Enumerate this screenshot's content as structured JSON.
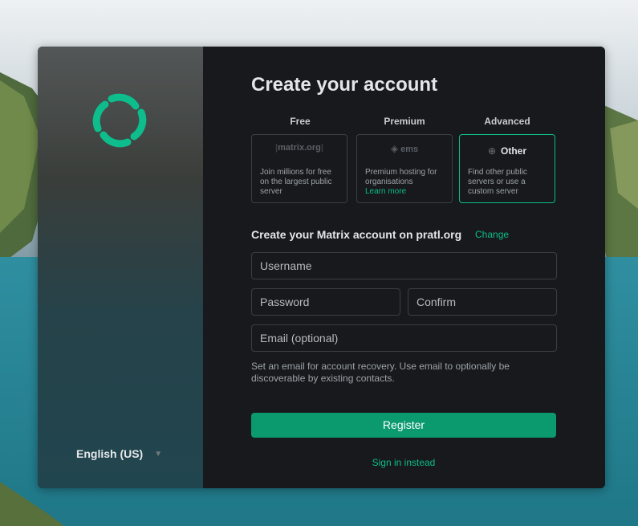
{
  "colors": {
    "accent": "#0dbd8b",
    "button": "#0b9a6e",
    "panel": "#17191c"
  },
  "sidebar": {
    "logo_icon": "element-logo-icon",
    "language": "English (US)",
    "language_chevron_icon": "chevron-down-icon"
  },
  "header": {
    "title": "Create your account"
  },
  "server_options": [
    {
      "tier": "Free",
      "brand": "matrix.org",
      "description": "Join millions for free on the largest public server",
      "link": "",
      "selected": false
    },
    {
      "tier": "Premium",
      "brand": "ems",
      "description": "Premium hosting for organisations",
      "link": "Learn more",
      "selected": false
    },
    {
      "tier": "Advanced",
      "brand": "Other",
      "brand_icon": "globe-icon",
      "description": "Find other public servers or use a custom server",
      "link": "",
      "selected": true
    }
  ],
  "account": {
    "heading": "Create your Matrix account on pratl.org",
    "change_label": "Change"
  },
  "form": {
    "username_placeholder": "Username",
    "password_placeholder": "Password",
    "confirm_placeholder": "Confirm",
    "email_placeholder": "Email (optional)",
    "email_hint": "Set an email for account recovery. Use email to optionally be discoverable by existing contacts.",
    "register_label": "Register",
    "signin_label": "Sign in instead"
  }
}
